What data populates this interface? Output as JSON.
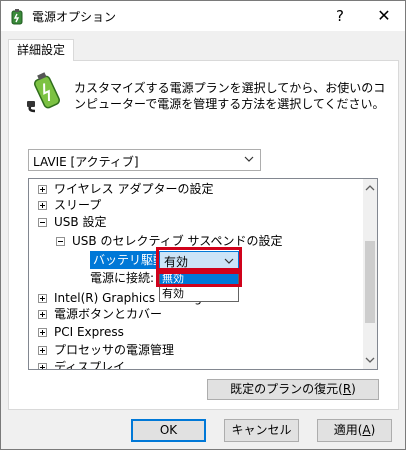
{
  "window": {
    "title": "電源オプション",
    "help_label": "?",
    "close_label": "✕"
  },
  "tab": {
    "label": "詳細設定"
  },
  "description": "カスタマイズする電源プランを選択してから、お使いのコンピューターで電源を管理する方法を選択してください。",
  "plan_select": {
    "value": "LAVIE [アクティブ]"
  },
  "tree": {
    "items": [
      {
        "label": "ワイヤレス アダプターの設定",
        "expander": "plus"
      },
      {
        "label": "スリープ",
        "expander": "plus"
      },
      {
        "label": "USB 設定",
        "expander": "minus"
      },
      {
        "label": "USB のセレクティブ サスペンドの設定",
        "expander": "minus"
      },
      {
        "label": "バッテリ駆動:",
        "selected": true
      },
      {
        "label": "電源に接続:"
      },
      {
        "label": "Intel(R) Graphics Settings",
        "expander": "plus"
      },
      {
        "label": "電源ボタンとカバー",
        "expander": "plus"
      },
      {
        "label": "PCI Express",
        "expander": "plus"
      },
      {
        "label": "プロセッサの電源管理",
        "expander": "plus"
      },
      {
        "label": "ディスプレイ",
        "expander": "plus"
      }
    ],
    "battery_combo_value": "有効",
    "dropdown_options": [
      "無効",
      "有効"
    ],
    "dropdown_selected": "無効"
  },
  "buttons": {
    "restore_label": "既定のプランの復元",
    "restore_key": "R",
    "ok_label": "OK",
    "cancel_label": "キャンセル",
    "apply_label": "適用",
    "apply_key": "A"
  },
  "colors": {
    "selection": "#0078d7",
    "highlight_box": "#d0021b",
    "background": "#f0f0f0"
  },
  "icons": {
    "title": "power-options-icon",
    "description": "battery-plug-icon"
  }
}
